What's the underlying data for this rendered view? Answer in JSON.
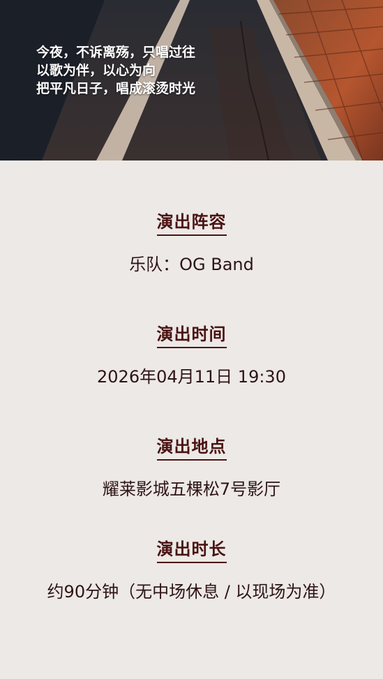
{
  "hero": {
    "lines": [
      "今夜，不诉离殇，只唱过往",
      "以歌为伴，以心为向",
      "把平凡日子，唱成滚烫时光"
    ]
  },
  "sections": [
    {
      "heading": "演出阵容",
      "value": "乐队：OG Band"
    },
    {
      "heading": "演出时间",
      "value": "2026年04月11日 19:30"
    },
    {
      "heading": "演出地点",
      "value": "耀莱影城五棵松7号影厅"
    },
    {
      "heading": "演出时长",
      "value": "约90分钟（无中场休息 / 以现场为准）"
    }
  ],
  "colors": {
    "background": "#ece9e6",
    "heading": "#4a1212",
    "text": "#2e1414"
  }
}
